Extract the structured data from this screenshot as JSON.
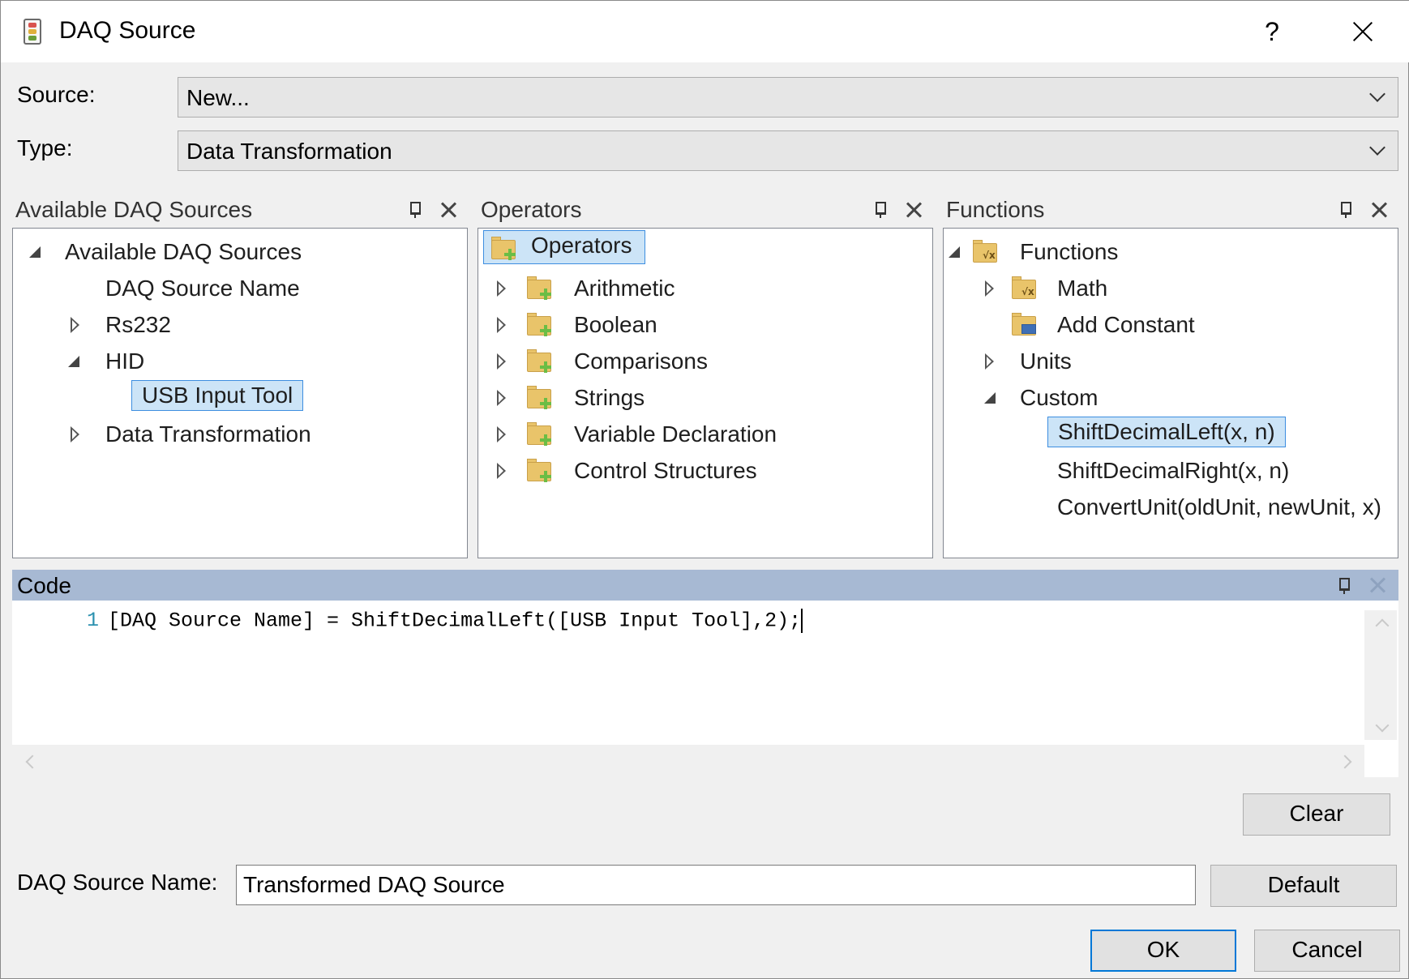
{
  "window": {
    "title": "DAQ Source",
    "help_label": "?"
  },
  "source": {
    "label": "Source:",
    "value": "New..."
  },
  "type": {
    "label": "Type:",
    "value": "Data Transformation"
  },
  "panels": {
    "available": {
      "title": "Available DAQ Sources",
      "nodes": [
        "Available DAQ Sources",
        "DAQ Source Name",
        "Rs232",
        "HID",
        "USB Input Tool",
        "Data Transformation"
      ]
    },
    "operators": {
      "title": "Operators",
      "nodes": [
        "Operators",
        "Arithmetic",
        "Boolean",
        "Comparisons",
        "Strings",
        "Variable Declaration",
        "Control Structures"
      ]
    },
    "functions": {
      "title": "Functions",
      "nodes": [
        "Functions",
        "Math",
        "Add Constant",
        "Units",
        "Custom",
        "ShiftDecimalLeft(x, n)",
        "ShiftDecimalRight(x, n)",
        "ConvertUnit(oldUnit, newUnit, x)"
      ]
    }
  },
  "code": {
    "title": "Code",
    "line_number": "1",
    "line_text": "[DAQ Source Name] = ShiftDecimalLeft([USB Input Tool],2);"
  },
  "buttons": {
    "clear": "Clear",
    "default": "Default",
    "ok": "OK",
    "cancel": "Cancel"
  },
  "name_field": {
    "label": "DAQ Source Name:",
    "value": "Transformed DAQ Source"
  },
  "icons": {
    "pin": "pin-icon",
    "close": "close-icon",
    "folder_add": "folder-add-icon",
    "folder_function": "folder-function-icon",
    "folder_doc": "folder-doc-icon"
  },
  "colors": {
    "selection": "#cce4f7",
    "selection_border": "#3d8ee0",
    "code_header": "#a7b9d3",
    "line_number": "#2b91af",
    "default_button_border": "#0078d7"
  }
}
